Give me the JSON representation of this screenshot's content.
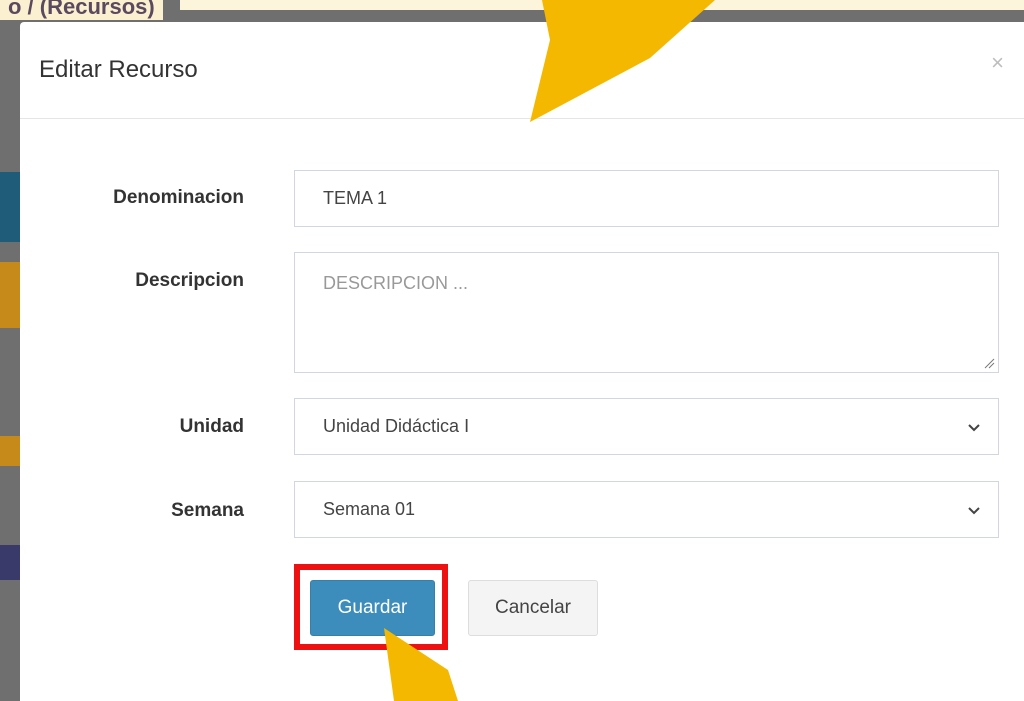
{
  "background": {
    "title": "o / (Recursos)",
    "strip_colors": [
      "#1e5c79",
      "#c68a1a",
      "#c68a1a",
      "#3a3a6a"
    ]
  },
  "modal": {
    "title": "Editar Recurso",
    "close_symbol": "×",
    "fields": {
      "denominacion": {
        "label": "Denominacion",
        "value": "TEMA 1"
      },
      "descripcion": {
        "label": "Descripcion",
        "placeholder": "DESCRIPCION ..."
      },
      "unidad": {
        "label": "Unidad",
        "value": "Unidad Didáctica I"
      },
      "semana": {
        "label": "Semana",
        "value": "Semana 01"
      }
    },
    "buttons": {
      "save": "Guardar",
      "cancel": "Cancelar"
    }
  },
  "colors": {
    "primary": "#3c8dbc",
    "highlight_box": "#ee1111",
    "arrow": "#f5b800"
  },
  "icons": [
    "close-icon",
    "chevron-down-icon",
    "resize-grip-icon",
    "arrow-pointer-icon"
  ]
}
